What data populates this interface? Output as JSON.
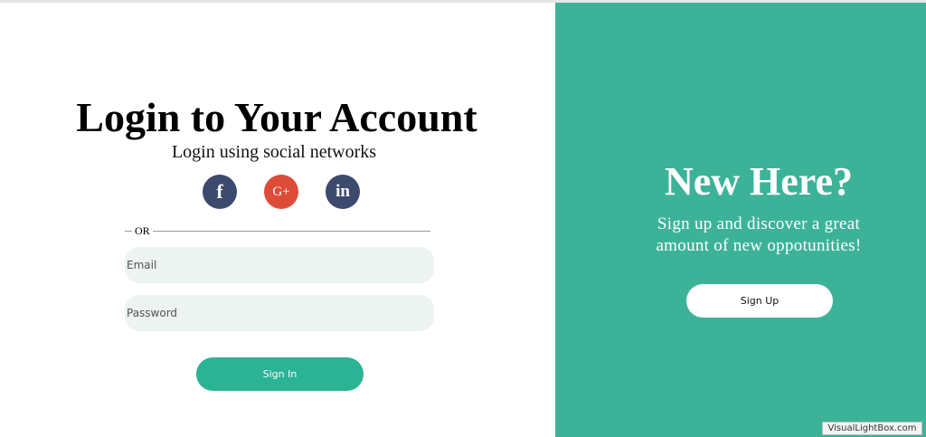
{
  "colors": {
    "accent": "#3cb399",
    "button_green": "#2ab394",
    "facebook": "#3c4a6e",
    "google_plus": "#dd4b39",
    "linkedin": "#3c4a6e",
    "input_bg": "#ecf3f0"
  },
  "login": {
    "title": "Login to Your Account",
    "subtitle": "Login using social networks",
    "social": [
      {
        "icon": "facebook-icon",
        "label": "f"
      },
      {
        "icon": "google-plus-icon",
        "label": "G+"
      },
      {
        "icon": "linkedin-icon",
        "label": "in"
      }
    ],
    "divider_text": "OR",
    "email_placeholder": "Email",
    "password_placeholder": "Password",
    "signin_label": "Sign In"
  },
  "signup_panel": {
    "title": "New Here?",
    "message_line1": "Sign up and discover a great",
    "message_line2": "amount of new oppotunities!",
    "signup_label": "Sign Up"
  },
  "watermark": "VisualLightBox.com"
}
